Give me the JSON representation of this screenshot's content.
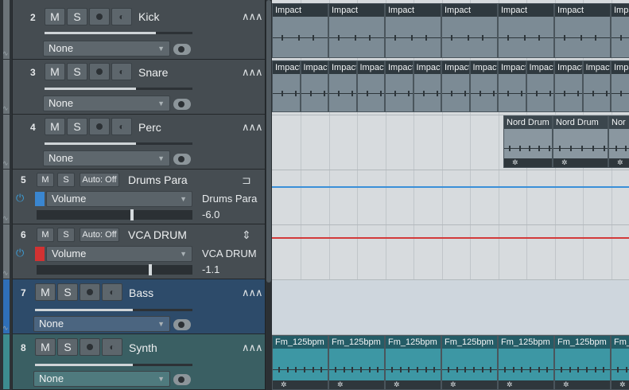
{
  "tracks": [
    {
      "num": "2",
      "name": "Kick",
      "mute": "M",
      "solo": "S",
      "input": "None",
      "volume_fraction": 0.75
    },
    {
      "num": "3",
      "name": "Snare",
      "mute": "M",
      "solo": "S",
      "input": "None",
      "volume_fraction": 0.62
    },
    {
      "num": "4",
      "name": "Perc",
      "mute": "M",
      "solo": "S",
      "input": "None",
      "volume_fraction": 0.62
    }
  ],
  "bus_tracks": [
    {
      "num": "5",
      "name": "Drums Para",
      "mute": "M",
      "solo": "S",
      "auto": "Auto: Off",
      "param": "Volume",
      "target": "Drums Para",
      "value": "-6.0",
      "color": "#3a86d0",
      "level_fraction": 0.6
    },
    {
      "num": "6",
      "name": "VCA DRUM",
      "mute": "M",
      "solo": "S",
      "auto": "Auto: Off",
      "param": "Volume",
      "target": "VCA DRUM",
      "value": "-1.1",
      "color": "#d23232",
      "level_fraction": 0.72
    }
  ],
  "lower_tracks": [
    {
      "num": "7",
      "name": "Bass",
      "mute": "M",
      "solo": "S",
      "input": "None",
      "volume_fraction": 0.62
    },
    {
      "num": "8",
      "name": "Synth",
      "mute": "M",
      "solo": "S",
      "input": "None",
      "volume_fraction": 0.62
    }
  ],
  "icons": {
    "waveform": "waveform-icon",
    "record": "record-icon",
    "monitor": "monitor-icon",
    "link": "link-icon",
    "power": "power-icon",
    "bus": "bus-icon",
    "vca": "vca-icon",
    "gear": "gear-icon"
  },
  "clips": {
    "kick_label": "Impact",
    "snare_label": "Impact",
    "perc_label_a": "Nord Drum",
    "perc_label_b": "Nord Drum",
    "perc_label_c": "Nor",
    "synth_label": "Fm_125bpm"
  },
  "colors": {
    "drums_para_line": "#3a8fd8",
    "vca_line": "#d23a3a"
  }
}
